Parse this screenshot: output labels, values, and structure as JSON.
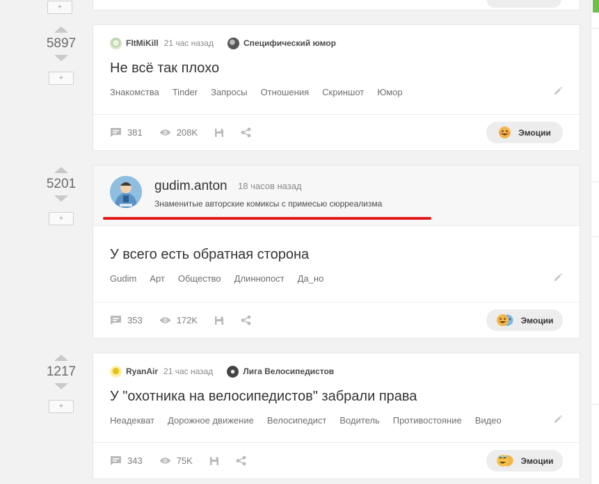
{
  "stories": [
    {
      "rating": "5897",
      "author": "FltMiKill",
      "time": "21 час назад",
      "community": "Специфический юмор",
      "title": "Не всё так плохо",
      "tags": [
        "Знакомства",
        "Tinder",
        "Запросы",
        "Отношения",
        "Скриншот",
        "Юмор"
      ],
      "comments": "381",
      "views": "208K",
      "emotions_label": "Эмоции"
    },
    {
      "rating": "5201",
      "author": "gudim.anton",
      "time": "18 часов назад",
      "description": "Знаменитые авторские комиксы с примесью сюрреализма",
      "title": "У всего есть обратная сторона",
      "tags": [
        "Gudim",
        "Арт",
        "Общество",
        "Длиннопост",
        "Да_но"
      ],
      "comments": "353",
      "views": "172K",
      "emotions_label": "Эмоции"
    },
    {
      "rating": "1217",
      "author": "RyanAir",
      "time": "21 час назад",
      "community": "Лига Велосипедистов",
      "title": "У \"охотника на велосипедистов\" забрали права",
      "tags": [
        "Неадекват",
        "Дорожное движение",
        "Велосипедист",
        "Водитель",
        "Противостояние",
        "Видео"
      ],
      "comments": "343",
      "views": "75K",
      "emotions_label": "Эмоции"
    }
  ],
  "plus_label": "+",
  "colors": {
    "accent_red": "#e21a1a",
    "green": "#6fbf4b"
  }
}
